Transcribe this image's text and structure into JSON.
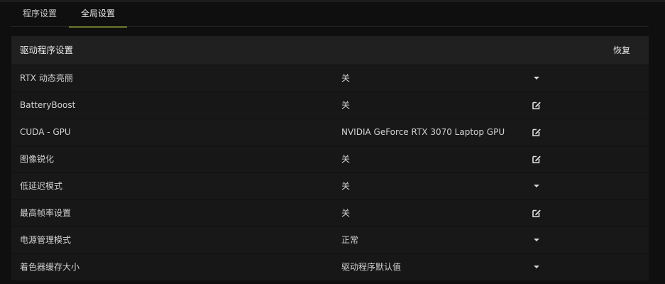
{
  "tabs": [
    {
      "label": "程序设置"
    },
    {
      "label": "全局设置"
    }
  ],
  "panel": {
    "title": "驱动程序设置",
    "reset_label": "恢复"
  },
  "rows": [
    {
      "name": "RTX 动态亮丽",
      "value": "关",
      "control": "dropdown-caret"
    },
    {
      "name": "BatteryBoost",
      "value": "关",
      "control": "edit-icon"
    },
    {
      "name": "CUDA - GPU",
      "value": "NVIDIA GeForce RTX 3070 Laptop GPU",
      "control": "edit-icon"
    },
    {
      "name": "图像锐化",
      "value": "关",
      "control": "edit-icon"
    },
    {
      "name": "低延迟模式",
      "value": "关",
      "control": "dropdown-caret"
    },
    {
      "name": "最高帧率设置",
      "value": "关",
      "control": "edit-icon"
    },
    {
      "name": "电源管理模式",
      "value": "正常",
      "control": "dropdown-caret"
    },
    {
      "name": "着色器缓存大小",
      "value": "驱动程序默认值",
      "control": "dropdown-caret"
    }
  ],
  "colors": {
    "background": "#0f0f0f",
    "header": "#202020",
    "row": "#181818",
    "active_tab_underline": "#6a7a2a"
  }
}
